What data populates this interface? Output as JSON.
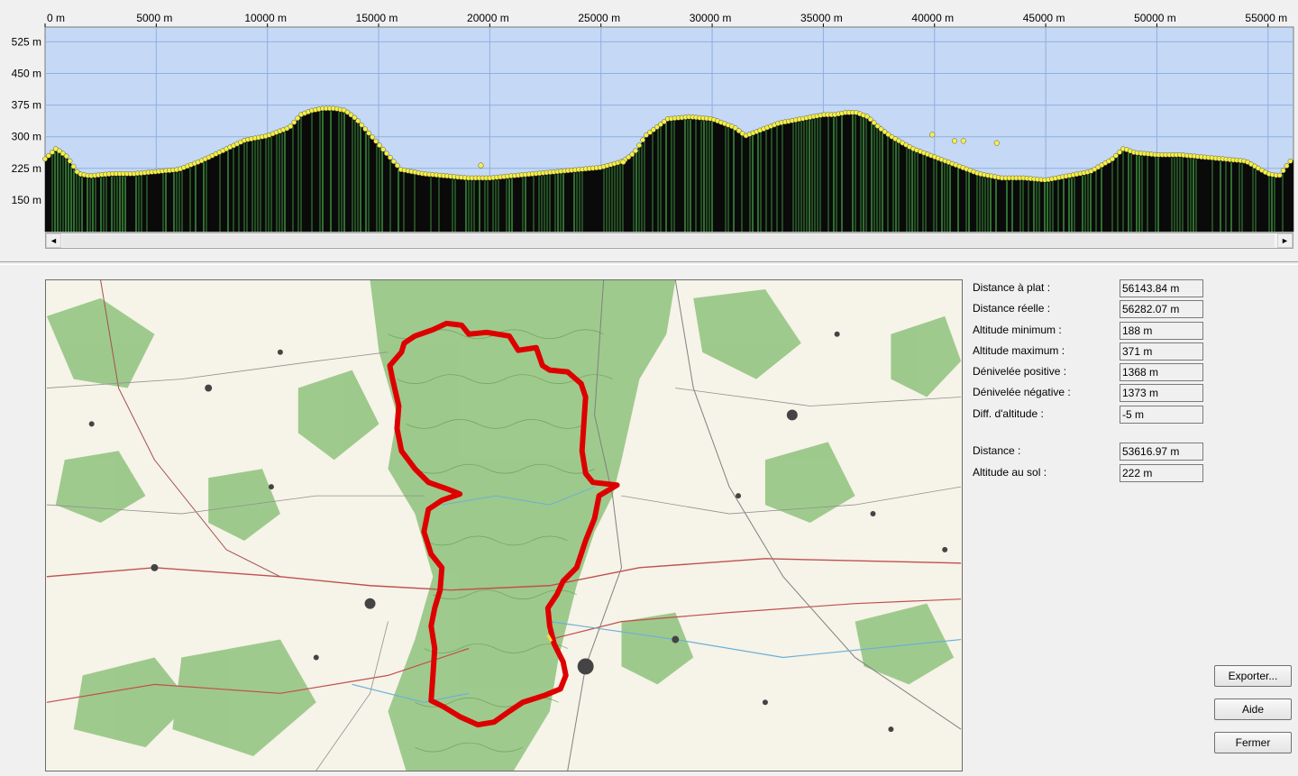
{
  "chart_data": {
    "type": "area",
    "x_ticks": [
      "0 m",
      "5000 m",
      "10000 m",
      "15000 m",
      "20000 m",
      "25000 m",
      "30000 m",
      "35000 m",
      "40000 m",
      "45000 m",
      "50000 m",
      "55000 m"
    ],
    "y_ticks": [
      "525 m",
      "450 m",
      "375 m",
      "300 m",
      "225 m",
      "150 m"
    ],
    "xlim": [
      0,
      56143.84
    ],
    "ylim": [
      75,
      560
    ],
    "grid": true,
    "series": [
      {
        "x": [
          0,
          500,
          1000,
          1500,
          2000,
          3000,
          4000,
          5000,
          6000,
          7000,
          8000,
          9000,
          10000,
          11000,
          11500,
          12000,
          12500,
          13000,
          13500,
          14000,
          14500,
          15000,
          16000,
          17000,
          18000,
          19000,
          20000,
          21000,
          22000,
          23000,
          24000,
          25000,
          26000,
          26500,
          27000,
          27500,
          28000,
          29000,
          30000,
          31000,
          31500,
          32000,
          33000,
          34000,
          35000,
          35500,
          36000,
          36500,
          37000,
          37500,
          38000,
          39000,
          40000,
          41000,
          42000,
          43000,
          44000,
          45000,
          46000,
          47000,
          48000,
          48500,
          49000,
          50000,
          51000,
          52000,
          53000,
          54000,
          54500,
          55000,
          55500,
          56000,
          56143
        ],
        "y": [
          245,
          270,
          250,
          210,
          205,
          210,
          210,
          215,
          220,
          240,
          265,
          290,
          300,
          320,
          350,
          360,
          365,
          365,
          360,
          340,
          310,
          280,
          220,
          210,
          205,
          200,
          200,
          205,
          210,
          215,
          220,
          225,
          240,
          260,
          300,
          320,
          340,
          345,
          340,
          320,
          300,
          310,
          330,
          340,
          350,
          350,
          355,
          355,
          345,
          320,
          300,
          270,
          250,
          230,
          210,
          200,
          200,
          195,
          205,
          215,
          245,
          270,
          260,
          255,
          255,
          250,
          245,
          240,
          225,
          210,
          205,
          240,
          245
        ]
      }
    ],
    "points_off_track": [
      {
        "x": 19600,
        "y": 232
      },
      {
        "x": 39900,
        "y": 305
      },
      {
        "x": 40900,
        "y": 290
      },
      {
        "x": 41300,
        "y": 290
      },
      {
        "x": 42800,
        "y": 285
      },
      {
        "x": 26000,
        "y": 240
      }
    ]
  },
  "stats": {
    "distance_plat": {
      "label": "Distance à plat :",
      "value": "56143.84 m"
    },
    "distance_reelle": {
      "label": "Distance réelle :",
      "value": "56282.07 m"
    },
    "altitude_min": {
      "label": "Altitude minimum :",
      "value": "188 m"
    },
    "altitude_max": {
      "label": "Altitude maximum :",
      "value": "371 m"
    },
    "denivele_pos": {
      "label": "Dénivelée positive :",
      "value": "1368 m"
    },
    "denivele_neg": {
      "label": "Dénivelée négative :",
      "value": "1373 m"
    },
    "diff_altitude": {
      "label": "Diff. d'altitude :",
      "value": "-5 m"
    },
    "distance": {
      "label": "Distance :",
      "value": "53616.97 m"
    },
    "altitude_sol": {
      "label": "Altitude au sol :",
      "value": "222 m"
    }
  },
  "buttons": {
    "export": "Exporter...",
    "help": "Aide",
    "close": "Fermer"
  },
  "scrollbar": {
    "left_icon": "arrow-left-icon",
    "right_icon": "arrow-right-icon",
    "left_glyph": "◄",
    "right_glyph": "►"
  },
  "colors": {
    "sky": "#c5d8f5",
    "terrain_fill": "#0a0a0a",
    "terrain_stripes": "#3c8f3c",
    "point": "#f6f040",
    "route": "#dd0000",
    "forest": "#8fc27c",
    "map_bg": "#f6f3e8"
  }
}
